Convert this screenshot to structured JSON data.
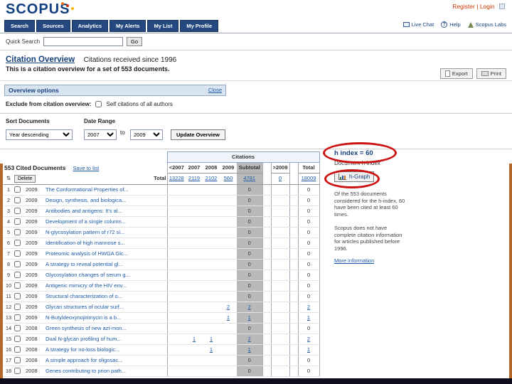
{
  "brand": {
    "name": "SCOPUS",
    "register": "Register",
    "divider": "|",
    "login": "Login"
  },
  "nav": {
    "items": [
      "Search",
      "Sources",
      "Analytics",
      "My Alerts",
      "My List",
      "My Profile"
    ],
    "right": [
      {
        "icon": "chat-icon",
        "label": "Live Chat"
      },
      {
        "icon": "help-icon",
        "label": "Help"
      },
      {
        "icon": "labs-icon",
        "label": "Scopus Labs"
      }
    ]
  },
  "icons": {
    "sort": "⇅",
    "help": "?"
  },
  "quick_search": {
    "label": "Quick Search",
    "button": "Go"
  },
  "header": {
    "title": "Citation Overview",
    "subtitle": "Citations received since 1996",
    "description": "This is a citation overview for a set of 553 documents.",
    "export": "Export",
    "print": "Print"
  },
  "options": {
    "header": "Overview options",
    "close": "Close",
    "exclude_label": "Exclude from citation overview:",
    "exclude_checkbox": "Self citations of all authors",
    "sort_label": "Sort Documents",
    "date_label": "Date Range",
    "sort_value": "Year descending",
    "year_from": "2007",
    "to_label": "to",
    "year_to": "2009",
    "update_button": "Update Overview"
  },
  "table": {
    "caption": "Citations",
    "cited_docs": "553 Cited Documents",
    "save_link": "Save to list",
    "delete_button": "Delete",
    "total_label": "Total",
    "columns": [
      "<2007",
      "2007",
      "2008",
      "2009",
      "Subtotal",
      ">2009",
      "Total"
    ],
    "totals": [
      "13228",
      "2119",
      "2102",
      "560",
      "4781",
      "0",
      "18009"
    ],
    "rows": [
      {
        "n": "1",
        "year": "2009",
        "title": "The Conformational Properties of...",
        "values": [
          "",
          "",
          "",
          "",
          "0",
          "",
          "0"
        ]
      },
      {
        "n": "2",
        "year": "2009",
        "title": "Design, synthesis, and biologica...",
        "values": [
          "",
          "",
          "",
          "",
          "0",
          "",
          "0"
        ]
      },
      {
        "n": "3",
        "year": "2009",
        "title": "Antibodies and antigens: It's al...",
        "values": [
          "",
          "",
          "",
          "",
          "0",
          "",
          "0"
        ]
      },
      {
        "n": "4",
        "year": "2009",
        "title": "Development of a single column...",
        "values": [
          "",
          "",
          "",
          "",
          "0",
          "",
          "0"
        ]
      },
      {
        "n": "5",
        "year": "2009",
        "title": "N-glycosylation pattern of r72 si...",
        "values": [
          "",
          "",
          "",
          "",
          "0",
          "",
          "0"
        ]
      },
      {
        "n": "6",
        "year": "2009",
        "title": "Identification of high mannose s...",
        "values": [
          "",
          "",
          "",
          "",
          "0",
          "",
          "0"
        ]
      },
      {
        "n": "7",
        "year": "2009",
        "title": "Proteomic analysis of HWGA Glc...",
        "values": [
          "",
          "",
          "",
          "",
          "0",
          "",
          "0"
        ]
      },
      {
        "n": "8",
        "year": "2009",
        "title": "A strategy to reveal potential gl...",
        "values": [
          "",
          "",
          "",
          "",
          "0",
          "",
          "0"
        ]
      },
      {
        "n": "9",
        "year": "2009",
        "title": "Glycosylation changes of serum g...",
        "values": [
          "",
          "",
          "",
          "",
          "0",
          "",
          "0"
        ]
      },
      {
        "n": "10",
        "year": "2009",
        "title": "Antigenic mimicry of the HIV env...",
        "values": [
          "",
          "",
          "",
          "",
          "0",
          "",
          "0"
        ]
      },
      {
        "n": "11",
        "year": "2009",
        "title": "Structural characterization of o...",
        "values": [
          "",
          "",
          "",
          "",
          "0",
          "",
          "0"
        ]
      },
      {
        "n": "12",
        "year": "2009",
        "title": "Glycan structures of ocular surf...",
        "values": [
          "",
          "",
          "",
          "2",
          "2",
          "",
          "2"
        ]
      },
      {
        "n": "13",
        "year": "2009",
        "title": "N-Butyldeoxynojirimycin is a b...",
        "values": [
          "",
          "",
          "",
          "1",
          "1",
          "",
          "1"
        ]
      },
      {
        "n": "14",
        "year": "2008",
        "title": "Green synthesis of new azt-mon...",
        "values": [
          "",
          "",
          "",
          "",
          "0",
          "",
          "0"
        ]
      },
      {
        "n": "15",
        "year": "2008",
        "title": "Dual N-glycan profiling of hum...",
        "values": [
          "",
          "1",
          "1",
          "",
          "2",
          "",
          "2"
        ]
      },
      {
        "n": "16",
        "year": "2008",
        "title": "A strategy for no-loss biologic...",
        "values": [
          "",
          "",
          "1",
          "",
          "1",
          "",
          "1"
        ]
      },
      {
        "n": "17",
        "year": "2008",
        "title": "A simple approach for oligosac...",
        "values": [
          "",
          "",
          "",
          "",
          "0",
          "",
          "0"
        ]
      },
      {
        "n": "18",
        "year": "2008",
        "title": "Genes contributing to prion path...",
        "values": [
          "",
          "",
          "",
          "",
          "0",
          "",
          "0"
        ]
      }
    ]
  },
  "sidebar": {
    "h_index": "h index = 60",
    "h_index_label": "Document h-index",
    "h_graph_button": "h-Graph",
    "note1": "Of the 553 documents considered for the h-index, 60 have been cited at least 60 times.",
    "note2": "Scopus does not have complete citation information for articles published before 1996.",
    "more_info": "More information"
  },
  "colors": {
    "accent": "#15427d",
    "link": "#1a5aa8",
    "annotation": "#cc1111",
    "subtotal_column": "#b9b9b9"
  }
}
